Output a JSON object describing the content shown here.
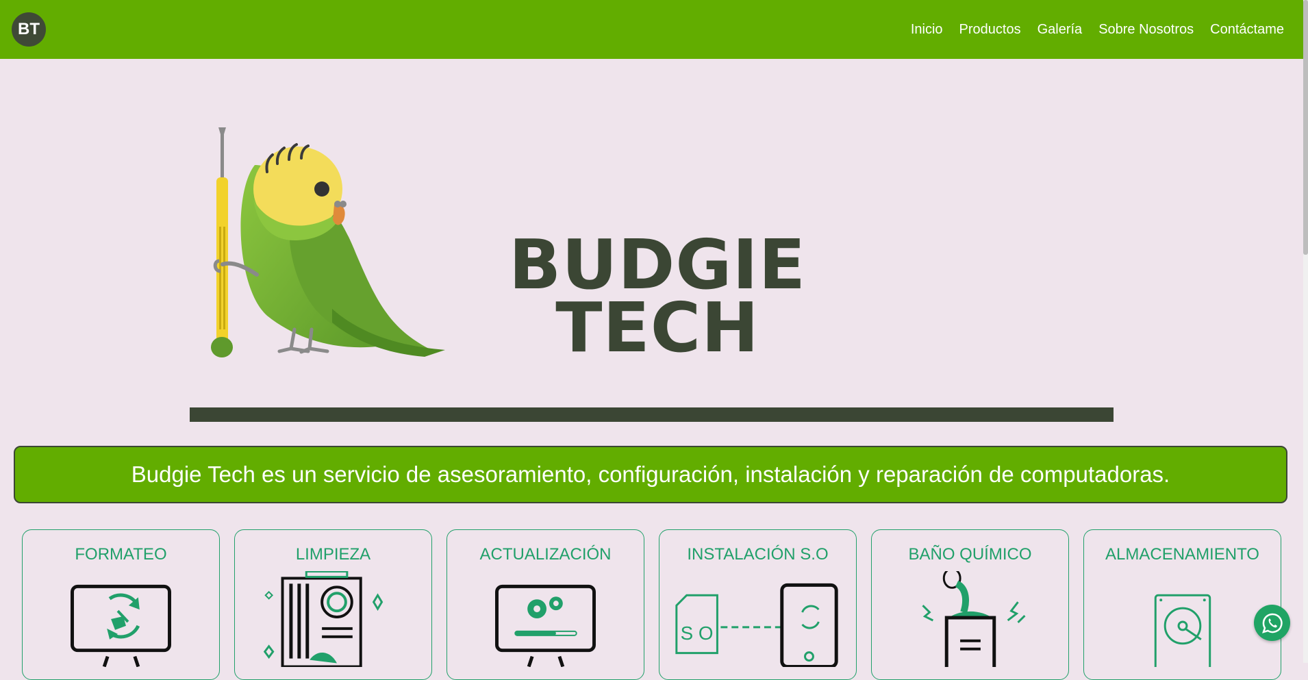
{
  "navbar": {
    "logo_text": "BT",
    "links": [
      "Inicio",
      "Productos",
      "Galería",
      "Sobre Nosotros",
      "Contáctame"
    ],
    "background": "#62ad00"
  },
  "hero": {
    "title_line1": "BUDGIE",
    "title_line2": "TECH",
    "mascot": "budgie-with-screwdriver-icon"
  },
  "banner": {
    "text": "Budgie Tech es un servicio de asesoramiento, configuración, instalación y reparación de computadoras."
  },
  "services": [
    {
      "title": "FORMATEO",
      "icon": "monitor-recycle-icon"
    },
    {
      "title": "LIMPIEZA",
      "icon": "pc-cleaning-icon"
    },
    {
      "title": "ACTUALIZACIÓN",
      "icon": "monitor-gears-icon"
    },
    {
      "title": "INSTALACIÓN S.O",
      "icon": "os-install-icon"
    },
    {
      "title": "BAÑO QUÍMICO",
      "icon": "chemical-bath-icon"
    },
    {
      "title": "ALMACENAMIENTO",
      "icon": "hard-drive-icon"
    }
  ],
  "whatsapp": {
    "icon": "whatsapp-icon"
  },
  "colors": {
    "accent": "#62ad00",
    "dark": "#3b4634",
    "card_green": "#21a06a",
    "page_bg": "#efe4ec"
  }
}
